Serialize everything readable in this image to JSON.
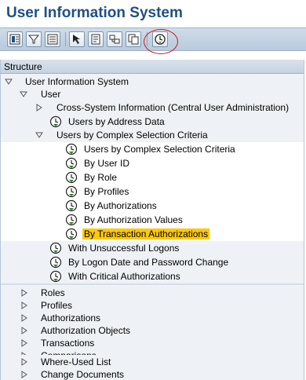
{
  "title": "User Information System",
  "toolbar": {
    "buttons": [
      "layout-icon",
      "filter-icon",
      "list-icon",
      "select-icon",
      "details-icon",
      "where-used-icon",
      "copy-icon",
      "execute-clock-icon"
    ]
  },
  "structure": {
    "header": "Structure",
    "root": "User Information System",
    "user": "User",
    "cross_system": "Cross-System Information (Central User Administration)",
    "users_by_address": "Users by Address Data",
    "complex_selection": "Users by Complex Selection Criteria",
    "complex_items": [
      "Users by Complex Selection Criteria",
      "By User ID",
      "By Role",
      "By Profiles",
      "By Authorizations",
      "By Authorization Values",
      "By Transaction Authorizations"
    ],
    "unsuccessful_logons": "With Unsuccessful Logons",
    "logon_date": "By Logon Date and Password Change",
    "critical_auth": "With Critical Authorizations",
    "top_level": [
      "Roles",
      "Profiles",
      "Authorizations",
      "Authorization Objects",
      "Transactions",
      "Comparisons",
      "Where-Used List",
      "Change Documents"
    ]
  },
  "colors": {
    "title": "#1f4f86",
    "selected_bg": "#ffc900",
    "highlight_ring": "#d01818",
    "clock": "#2f7d2f"
  }
}
